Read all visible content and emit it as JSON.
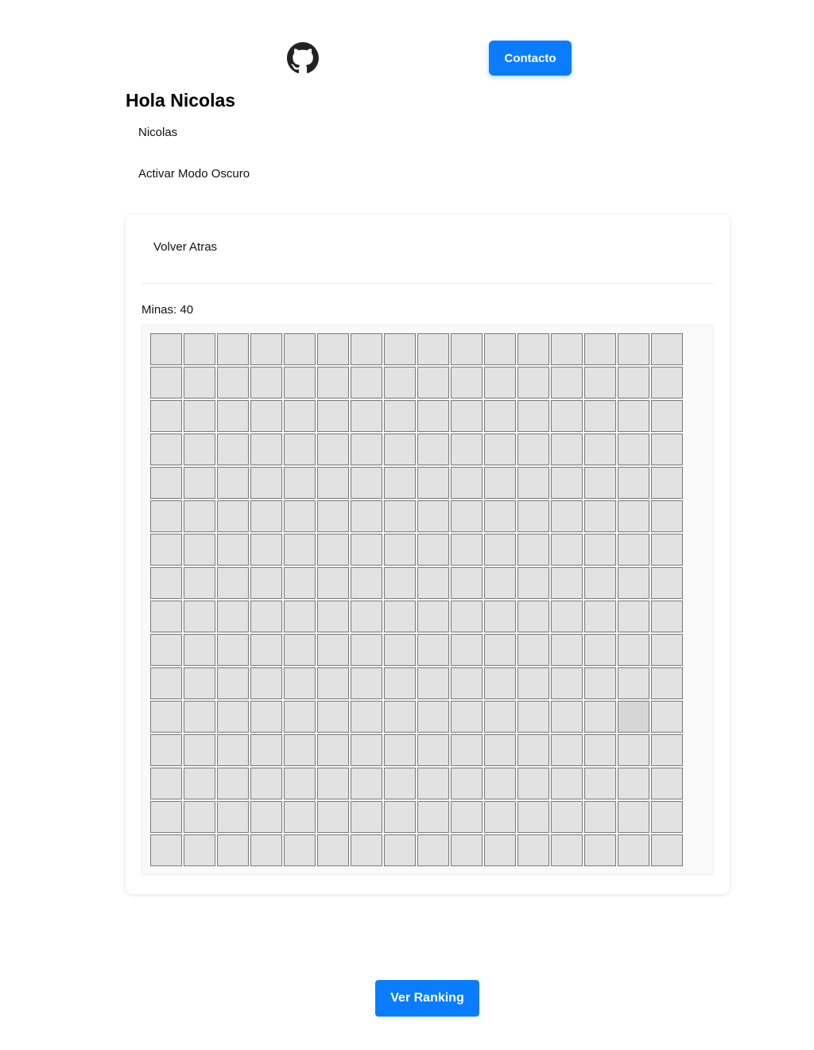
{
  "header": {
    "github_icon": "github-icon",
    "contact_label": "Contacto"
  },
  "user": {
    "greeting": "Hola Nicolas",
    "name": "Nicolas",
    "dark_mode_label": "Activar Modo Oscuro"
  },
  "game": {
    "back_label": "Volver Atras",
    "mines_label": "Minas: 40",
    "rows": 16,
    "cols": 16,
    "highlighted_cell": {
      "row": 11,
      "col": 14
    }
  },
  "footer": {
    "ranking_label": "Ver Ranking"
  },
  "colors": {
    "accent": "#0a7cff",
    "cell_fill": "#e2e2e2",
    "cell_border": "#7a7a7a"
  }
}
